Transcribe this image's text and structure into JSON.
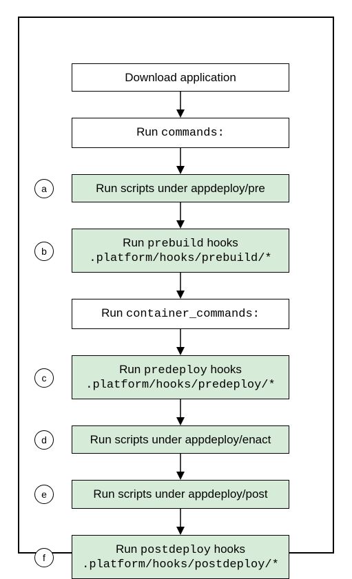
{
  "steps": [
    {
      "type": "plain",
      "text": "Download application"
    },
    {
      "type": "mixed",
      "prefix": "Run ",
      "mono": "commands:",
      "suffix": ""
    },
    {
      "type": "plain",
      "text": "Run scripts under appdeploy/pre",
      "green": true,
      "bullet": "a"
    },
    {
      "type": "twoline",
      "line1_prefix": "Run ",
      "line1_mono": "prebuild",
      "line1_suffix": " hooks",
      "line2_mono": ".platform/hooks/prebuild/*",
      "green": true,
      "bullet": "b"
    },
    {
      "type": "mixed",
      "prefix": "Run ",
      "mono": "container_commands:",
      "suffix": ""
    },
    {
      "type": "twoline",
      "line1_prefix": "Run ",
      "line1_mono": "predeploy",
      "line1_suffix": " hooks",
      "line2_mono": ".platform/hooks/predeploy/*",
      "green": true,
      "bullet": "c"
    },
    {
      "type": "plain",
      "text": "Run scripts under appdeploy/enact",
      "green": true,
      "bullet": "d"
    },
    {
      "type": "plain",
      "text": "Run scripts under appdeploy/post",
      "green": true,
      "bullet": "e"
    },
    {
      "type": "twoline",
      "line1_prefix": "Run ",
      "line1_mono": "postdeploy",
      "line1_suffix": " hooks",
      "line2_mono": ".platform/hooks/postdeploy/*",
      "green": true,
      "bullet": "f"
    }
  ]
}
